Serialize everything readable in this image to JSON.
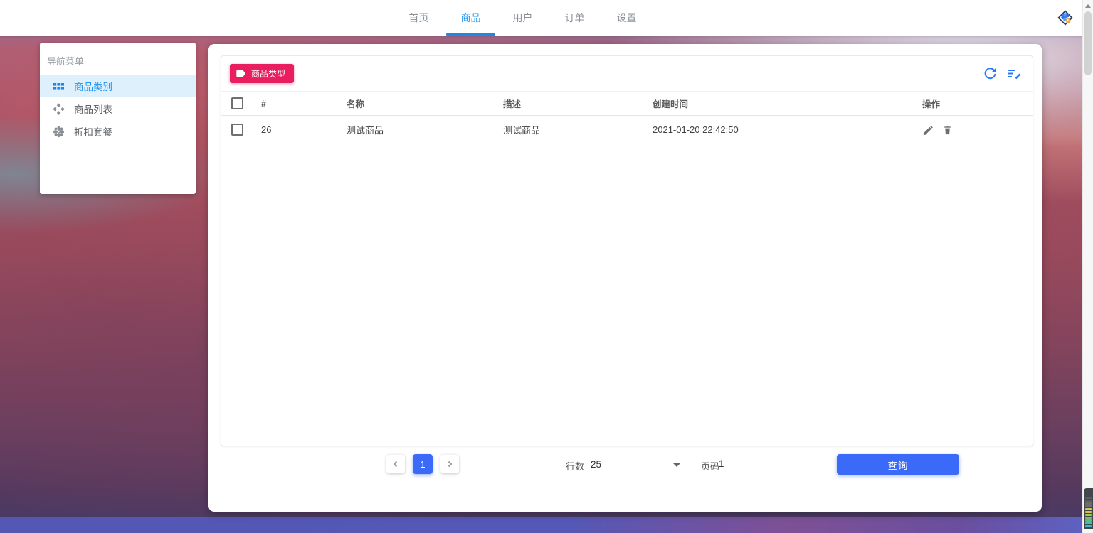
{
  "app": {
    "accent_blue": "#2196f3",
    "primary_blue": "#3b6af8",
    "pink": "#e91e5f"
  },
  "navbar": {
    "tabs": [
      {
        "label": "首页",
        "active": false
      },
      {
        "label": "商品",
        "active": true
      },
      {
        "label": "用户",
        "active": false
      },
      {
        "label": "订单",
        "active": false
      },
      {
        "label": "设置",
        "active": false
      }
    ]
  },
  "sidebar": {
    "title": "导航菜单",
    "items": [
      {
        "label": "商品类别",
        "icon": "grid-icon",
        "active": true
      },
      {
        "label": "商品列表",
        "icon": "diamonds-icon",
        "active": false
      },
      {
        "label": "折扣套餐",
        "icon": "badge-icon",
        "active": false
      }
    ]
  },
  "toolbar": {
    "type_button_label": "商品类型"
  },
  "table": {
    "columns": [
      "#",
      "名称",
      "描述",
      "创建时间",
      "操作"
    ],
    "rows": [
      {
        "id": "26",
        "name": "测试商品",
        "description": "测试商品",
        "created_at": "2021-01-20 22:42:50"
      }
    ]
  },
  "pagination": {
    "current_page": "1",
    "rows_label": "行数",
    "rows_value": "25",
    "page_label": "页码",
    "page_value": "1",
    "query_label": "查询"
  },
  "icons": {
    "logo-icon": "diamond-grape-cluster",
    "grid-icon": "module-grid",
    "diamonds-icon": "four-diamonds",
    "badge-icon": "discount-seal",
    "tag-icon": "label-tag",
    "refresh-icon": "circular-arrow",
    "edit-list-icon": "lines-with-pencil",
    "edit-icon": "pencil",
    "delete-icon": "trash-bin",
    "prev-icon": "chevron-left",
    "next-icon": "chevron-right",
    "dropdown-icon": "caret-down"
  }
}
